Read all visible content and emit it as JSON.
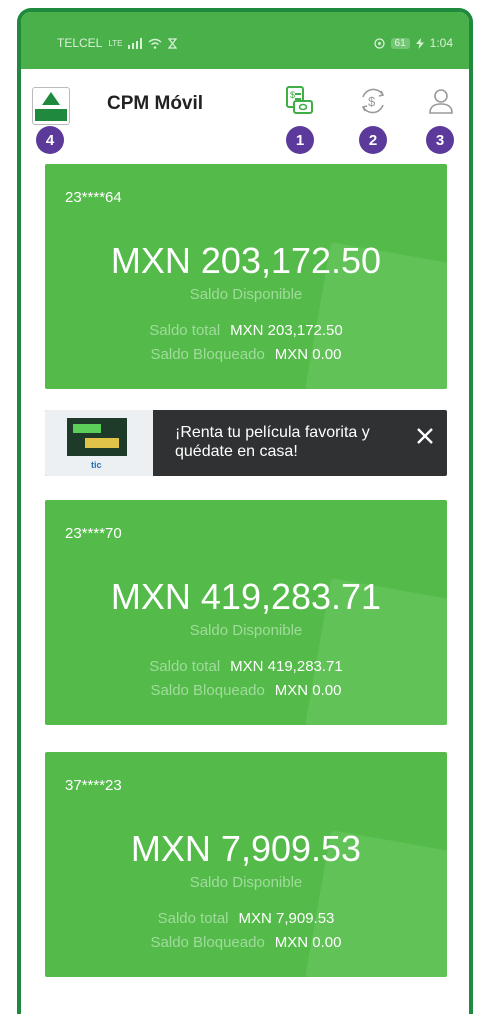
{
  "status_bar": {
    "carrier": "TELCEL",
    "network": "LTE",
    "battery": "61",
    "time": "1:04"
  },
  "header": {
    "title": "CPM Móvil",
    "logo_icon": "caja-popular-mexicana-logo",
    "actions": [
      {
        "icon": "cash-transfer-icon",
        "badge": "1"
      },
      {
        "icon": "currency-exchange-icon",
        "badge": "2"
      },
      {
        "icon": "user-profile-icon",
        "badge": "3"
      }
    ],
    "logo_badge": "4"
  },
  "accounts": [
    {
      "number": "23****64",
      "available": "MXN 203,172.50",
      "available_label": "Saldo Disponible",
      "total_label": "Saldo total",
      "total": "MXN 203,172.50",
      "blocked_label": "Saldo Bloqueado",
      "blocked": "MXN 0.00"
    },
    {
      "number": "23****70",
      "available": "MXN 419,283.71",
      "available_label": "Saldo Disponible",
      "total_label": "Saldo total",
      "total": "MXN 419,283.71",
      "blocked_label": "Saldo Bloqueado",
      "blocked": "MXN 0.00"
    },
    {
      "number": "37****23",
      "available": "MXN 7,909.53",
      "available_label": "Saldo Disponible",
      "total_label": "Saldo total",
      "total": "MXN 7,909.53",
      "blocked_label": "Saldo Bloqueado",
      "blocked": "MXN 0.00"
    }
  ],
  "ad_banner": {
    "message": "¡Renta tu película favorita y quédate en casa!",
    "brand": "tic"
  },
  "colors": {
    "brand_green": "#1f8a3d",
    "card_green": "#54bb4a",
    "badge_purple": "#5b3a9b"
  }
}
